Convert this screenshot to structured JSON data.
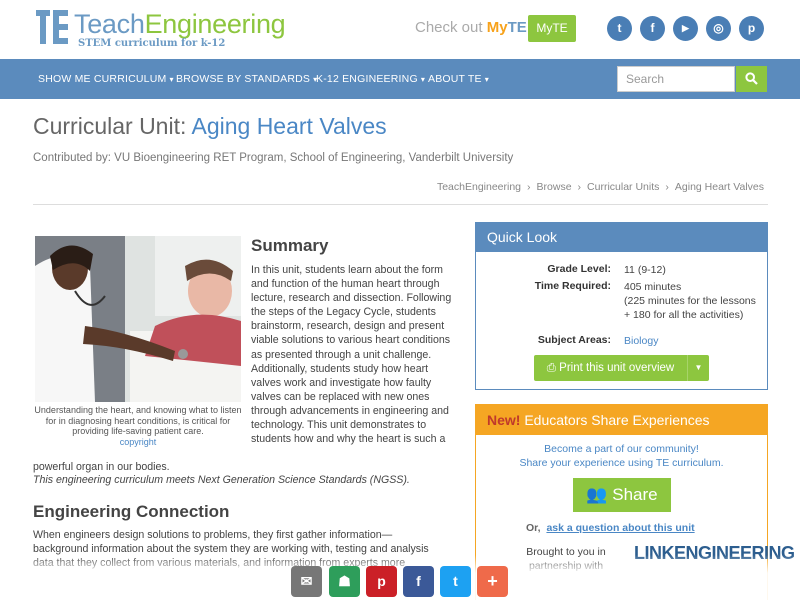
{
  "brand": {
    "name_part1": "Teach",
    "name_part2": "Engineering",
    "tagline": "STEM curriculum for k-12"
  },
  "promo": {
    "prefix": "Check out ",
    "my": "My",
    "te": "TE",
    "button": "MyTE"
  },
  "social": [
    {
      "name": "twitter",
      "glyph": "t"
    },
    {
      "name": "facebook",
      "glyph": "f"
    },
    {
      "name": "youtube",
      "glyph": "▶"
    },
    {
      "name": "instagram",
      "glyph": "◎"
    },
    {
      "name": "pinterest",
      "glyph": "p"
    }
  ],
  "nav": {
    "items": [
      "SHOW ME CURRICULUM",
      "BROWSE BY STANDARDS",
      "K-12 ENGINEERING",
      "ABOUT TE"
    ],
    "search_placeholder": "Search"
  },
  "page": {
    "title_prefix": "Curricular Unit: ",
    "title": "Aging Heart Valves",
    "contributed": "Contributed by: VU Bioengineering RET Program, School of Engineering, Vanderbilt University",
    "breadcrumb": [
      "TeachEngineering",
      "Browse",
      "Curricular Units",
      "Aging Heart Valves"
    ]
  },
  "summary": {
    "heading": "Summary",
    "text": "In this unit, students learn about the form and function of the human heart through lecture, research and dissection. Following the steps of the Legacy Cycle, students brainstorm, research, design and present viable solutions to various heart conditions as presented through a unit challenge. Additionally, students study how heart valves work and investigate how faulty valves can be replaced with new ones through advancements in engineering and technology. This unit demonstrates to students how and why the heart is such a",
    "text_tail": "powerful organ in our bodies.",
    "ngss": "This engineering curriculum meets Next Generation Science Standards (NGSS).",
    "caption": "Understanding the heart, and knowing what to listen for in diagnosing heart conditions, is critical for providing life-saving patient care.",
    "copyright": "copyright"
  },
  "engineering": {
    "heading": "Engineering Connection",
    "text": "When engineers design solutions to problems, they first gather information—background information about the system they are working with, testing and analysis data that they collect from various materials, and information from experts more"
  },
  "quick_look": {
    "heading": "Quick Look",
    "grade_label": "Grade Level:",
    "grade_value": "11 (9-12)",
    "time_label": "Time Required:",
    "time_line1": "405 minutes",
    "time_line2": "(225 minutes for the lessons",
    "time_line3": "+ 180 for all the activities)",
    "subject_label": "Subject Areas:",
    "subject_value": "Biology",
    "print_button": "Print this unit overview"
  },
  "share": {
    "new_label": "New!",
    "heading": " Educators Share Experiences",
    "line1": "Become a part of our community!",
    "line2": "Share your experience using TE curriculum.",
    "button": "Share",
    "or": "Or,",
    "ask": "ask a question about this unit",
    "brought": "Brought to you in partnership with",
    "partner": "LINKENGINEERING"
  },
  "floating_bar": [
    {
      "name": "email",
      "glyph": "✉",
      "color": "#777777"
    },
    {
      "name": "google-classroom",
      "glyph": "☗",
      "color": "#2e9e5b"
    },
    {
      "name": "pinterest",
      "glyph": "p",
      "color": "#cb2027"
    },
    {
      "name": "facebook",
      "glyph": "f",
      "color": "#3b5998"
    },
    {
      "name": "twitter",
      "glyph": "t",
      "color": "#1da1f2"
    },
    {
      "name": "more",
      "glyph": "+",
      "color": "#ef6a4a"
    }
  ],
  "colors": {
    "brand_blue": "#5b8bbd",
    "brand_green": "#8dc63f",
    "accent_orange": "#f5a623"
  }
}
